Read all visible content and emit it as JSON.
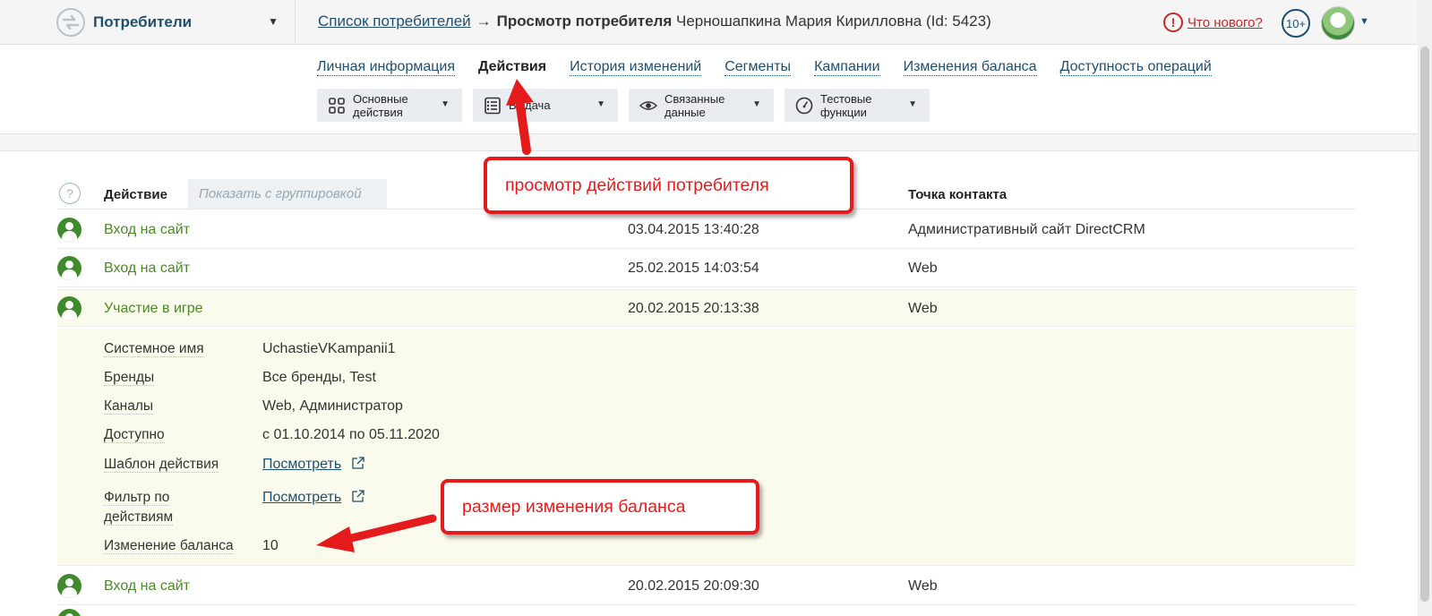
{
  "header": {
    "app_name": "Потребители",
    "breadcrumb_link": "Список потребителей",
    "breadcrumb_arrow": "→",
    "breadcrumb_current": "Просмотр потребителя",
    "breadcrumb_rest": " Черношапкина Мария Кирилловна (Id: 5423)",
    "whatsnew_label": "Что нового?",
    "notifications_count": "10+"
  },
  "tabs": [
    {
      "label": "Личная информация",
      "active": false
    },
    {
      "label": "Действия",
      "active": true
    },
    {
      "label": "История изменений",
      "active": false
    },
    {
      "label": "Сегменты",
      "active": false
    },
    {
      "label": "Кампании",
      "active": false
    },
    {
      "label": "Изменения баланса",
      "active": false
    },
    {
      "label": "Доступность операций",
      "active": false
    }
  ],
  "toolbar": [
    {
      "label": "Основные действия",
      "icon": "grid-icon"
    },
    {
      "label": "Выдача",
      "icon": "list-icon"
    },
    {
      "label": "Связанные данные",
      "icon": "eye-icon"
    },
    {
      "label": "Тестовые функции",
      "icon": "gauge-icon"
    }
  ],
  "table": {
    "col_action": "Действие",
    "group_button": "Показать с группировкой",
    "col_contact": "Точка контакта",
    "rows": [
      {
        "action": "Вход на сайт",
        "date": "03.04.2015 13:40:28",
        "contact": "Административный сайт DirectCRM"
      },
      {
        "action": "Вход на сайт",
        "date": "25.02.2015 14:03:54",
        "contact": "Web"
      },
      {
        "action": "Участие в игре",
        "date": "20.02.2015 20:13:38",
        "contact": "Web"
      },
      {
        "action": "Вход на сайт",
        "date": "20.02.2015 20:09:30",
        "contact": "Web"
      }
    ],
    "details": {
      "system_name_label": "Системное имя",
      "system_name_value": "UchastieVKampanii1",
      "brands_label": "Бренды",
      "brands_value": "Все бренды, Test",
      "channels_label": "Каналы",
      "channels_value": "Web, Администратор",
      "available_label": "Доступно",
      "available_value": "с 01.10.2014 по 05.11.2020",
      "template_label": "Шаблон действия",
      "template_link": "Посмотреть",
      "filter_label_1": "Фильтр по",
      "filter_label_2": "действиям",
      "filter_link": "Посмотреть",
      "balance_label": "Изменение баланса",
      "balance_value": "10"
    }
  },
  "annotations": {
    "callout_actions": "просмотр действий потребителя",
    "callout_balance": "размер изменения баланса"
  },
  "colors": {
    "accent": "#1f4f70",
    "action_green": "#4a8a23",
    "annotation_red": "#e51b1b",
    "highlight_row": "#fbfbed"
  }
}
